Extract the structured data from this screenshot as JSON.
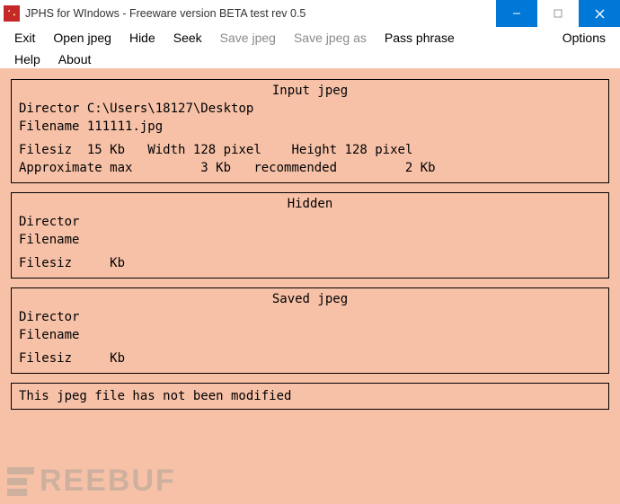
{
  "window": {
    "title": "JPHS for WIndows - Freeware version BETA test rev 0.5"
  },
  "menu": {
    "row1": {
      "exit": "Exit",
      "open": "Open jpeg",
      "hide": "Hide",
      "seek": "Seek",
      "save": "Save jpeg",
      "saveas": "Save jpeg as",
      "pass": "Pass phrase",
      "options": "Options"
    },
    "row2": {
      "help": "Help",
      "about": "About"
    }
  },
  "input_panel": {
    "title": "Input jpeg",
    "dir_label": "Director",
    "dir_value": "C:\\Users\\18127\\Desktop",
    "file_label": "Filename",
    "file_value": "111111.jpg",
    "filesize_label": "Filesiz",
    "filesize_value": "15 Kb",
    "width_label": "Width",
    "width_value": "128 pixel",
    "height_label": "Height",
    "height_value": "128 pixel",
    "approx_label": "Approximate max",
    "approx_value": "3 Kb",
    "rec_label": "recommended",
    "rec_value": "2 Kb"
  },
  "hidden_panel": {
    "title": "Hidden",
    "dir_label": "Director",
    "dir_value": "",
    "file_label": "Filename",
    "file_value": "",
    "filesize_label": "Filesiz",
    "filesize_value": "Kb"
  },
  "saved_panel": {
    "title": "Saved jpeg",
    "dir_label": "Director",
    "dir_value": "",
    "file_label": "Filename",
    "file_value": "",
    "filesize_label": "Filesiz",
    "filesize_value": "Kb"
  },
  "status": {
    "text": "This jpeg file has not been modified"
  },
  "watermark": {
    "text": "REEBUF"
  }
}
